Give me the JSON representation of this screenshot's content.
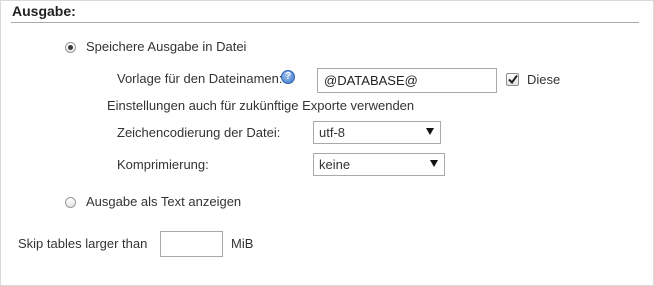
{
  "section": {
    "title": "Ausgabe:"
  },
  "save_to_file": {
    "label": "Speichere Ausgabe in Datei",
    "selected": true
  },
  "filename_template": {
    "label": "Vorlage für den Dateinamen:",
    "value": "@DATABASE@",
    "help_icon": "help-question-icon",
    "remember_checkbox_label": "Diese",
    "remember_checked": true
  },
  "future_exports_text": "Einstellungen auch für zukünftige Exporte verwenden",
  "charset": {
    "label": "Zeichencodierung der Datei:",
    "selected": "utf-8"
  },
  "compression": {
    "label": "Komprimierung:",
    "selected": "keine"
  },
  "output_as_text": {
    "label": "Ausgabe als Text anzeigen",
    "selected": false
  },
  "skip_tables": {
    "label": "Skip tables larger than",
    "value": "",
    "unit": "MiB"
  }
}
